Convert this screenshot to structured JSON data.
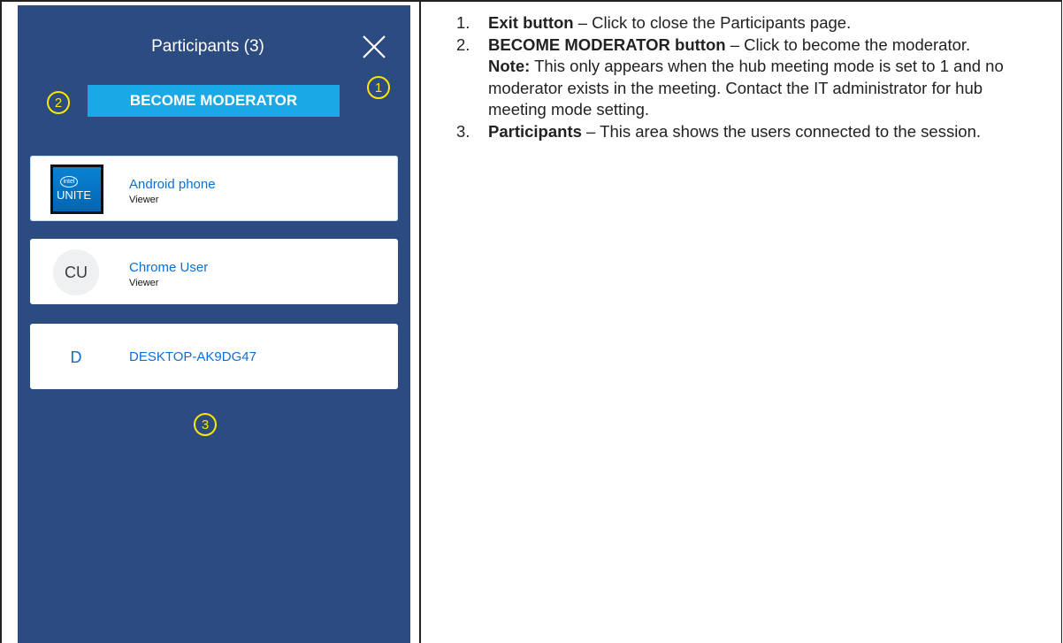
{
  "panel": {
    "title": "Participants (3)",
    "moderator_button_label": "BECOME MODERATOR",
    "callouts": [
      "1",
      "2",
      "3"
    ],
    "participants": [
      {
        "name": "Android phone",
        "role": "Viewer",
        "avatar": "intel-unite-logo",
        "logo_small": "intel",
        "logo_text": "UNITE"
      },
      {
        "name": "Chrome User",
        "role": "Viewer",
        "avatar_text": "CU"
      },
      {
        "name": "DESKTOP-AK9DG47",
        "avatar_text": "D"
      }
    ]
  },
  "description": {
    "items": [
      {
        "number": "1.",
        "term": "Exit button",
        "text": " – Click to close the Participants page."
      },
      {
        "number": "2.",
        "term": "BECOME MODERATOR button",
        "text": " – Click to become the moderator.",
        "note_label": "Note:",
        "note_text": " This only appears when the hub meeting mode is set to 1 and no moderator exists in the meeting. Contact the IT administrator for hub meeting mode setting."
      },
      {
        "number": "3.",
        "term": "Participants",
        "text": " – This area shows the users connected to the session."
      }
    ]
  },
  "colors": {
    "panel_bg": "#2c4b81",
    "button_bg": "#1aa8e6",
    "callout": "#ffe600",
    "name_text": "#0a6fd6"
  },
  "icons": {
    "close": "close-icon"
  }
}
